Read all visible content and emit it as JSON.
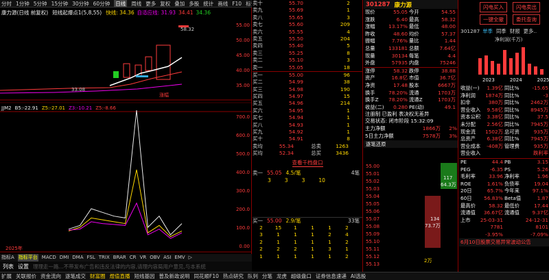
{
  "topbar": {
    "items": [
      "分时",
      "1分钟",
      "5分钟",
      "15分钟",
      "30分钟",
      "60分钟",
      "日线",
      "周线",
      "更多",
      "复权",
      "叠加",
      "多股",
      "统计",
      "画线",
      "F10",
      "标记",
      "-",
      "+",
      "□"
    ],
    "selected": 6
  },
  "chart": {
    "title": "康力源(日线 前复权)",
    "ma_label": "短线起爆点1(5,8,55)",
    "ma_vals": [
      {
        "t": "快线: 34.36",
        "c": "#ffd700"
      },
      {
        "t": "自适应线: 31.93",
        "c": "#e0e"
      },
      {
        "t": "34.41",
        "c": "#ff3b3b"
      },
      {
        "t": "34.36",
        "c": "#22cc22"
      }
    ],
    "high_label": "58.32",
    "low_label": "33.08",
    "price_axis": [
      "55.00",
      "50.00",
      "45.00",
      "40.00",
      "35.00"
    ],
    "tag": "涨幅",
    "ind_label": "JJM2",
    "ind_vals": [
      {
        "t": "B5:-22.91",
        "c": "#eee"
      },
      {
        "t": "Z5:-27.01",
        "c": "#ffd700"
      },
      {
        "t": "Z3:-10.21",
        "c": "#e0e"
      },
      {
        "t": "Z5:-8.66",
        "c": "#ff3b3b"
      }
    ],
    "ind_axis": [
      "700.0",
      "600.0",
      "500.0",
      "400.0",
      "300.0",
      "200.0",
      "100.0",
      "0.00"
    ],
    "year": "2025年",
    "ind_x": [
      0,
      1,
      2,
      3,
      4,
      5,
      6,
      7,
      8,
      9,
      10
    ],
    "ind_series": [
      {
        "c": "#eee",
        "v": [
          60,
          80,
          170,
          150,
          130,
          120,
          700,
          70,
          130,
          30,
          90
        ]
      },
      {
        "t": "",
        "c": "#ffd700",
        "v": [
          50,
          70,
          120,
          110,
          100,
          90,
          380,
          40,
          80,
          20,
          50
        ]
      },
      {
        "c": "#e0e",
        "v": [
          55,
          60,
          100,
          90,
          85,
          80,
          200,
          30,
          60,
          10,
          40
        ]
      }
    ]
  },
  "tabbar": {
    "items": [
      "指标A",
      "指标平台",
      "MACD",
      "DMI",
      "DMA",
      "FSL",
      "TRIX",
      "BRAR",
      "CR",
      "VR",
      "OBV",
      "ASI",
      "EMV",
      "▷"
    ],
    "hl": 1
  },
  "quote": {
    "code": "301287",
    "name": "康力源",
    "sell": [
      {
        "l": "卖十",
        "p": "55.70",
        "v": "2"
      },
      {
        "l": "卖九",
        "p": "55.69",
        "v": "1"
      },
      {
        "l": "卖八",
        "p": "55.65",
        "v": "3"
      },
      {
        "l": "卖七",
        "p": "55.60",
        "v": "209"
      },
      {
        "l": "卖六",
        "p": "55.55",
        "v": "4"
      },
      {
        "l": "卖五",
        "p": "55.50",
        "v": "204"
      },
      {
        "l": "卖四",
        "p": "55.40",
        "v": "5"
      },
      {
        "l": "卖三",
        "p": "55.25",
        "v": "8"
      },
      {
        "l": "卖二",
        "p": "55.10",
        "v": "3"
      },
      {
        "l": "卖一",
        "p": "55.05",
        "v": "18"
      }
    ],
    "buy": [
      {
        "l": "买一",
        "p": "55.00",
        "v": "96"
      },
      {
        "l": "买二",
        "p": "54.99",
        "v": "38"
      },
      {
        "l": "买三",
        "p": "54.98",
        "v": "190"
      },
      {
        "l": "买四",
        "p": "54.97",
        "v": "15"
      },
      {
        "l": "买五",
        "p": "54.96",
        "v": "214"
      },
      {
        "l": "买六",
        "p": "54.95",
        "v": "1"
      },
      {
        "l": "买七",
        "p": "54.94",
        "v": "1"
      },
      {
        "l": "买八",
        "p": "54.93",
        "v": "1"
      },
      {
        "l": "买九",
        "p": "54.92",
        "v": "1"
      },
      {
        "l": "买十",
        "p": "54.91",
        "v": "8"
      }
    ],
    "avg1": "卖均",
    "avg1v": "55.34",
    "avg1t": "总卖",
    "avg1n": "1263",
    "avg2": "买均",
    "avg2v": "52.34",
    "avg2t": "总买",
    "avg2n": "3436",
    "stats": [
      [
        "现价",
        "55.05",
        "今开",
        "54.55"
      ],
      [
        "涨跌",
        "6.40",
        "最高",
        "58.32"
      ],
      [
        "涨幅",
        "13.17%",
        "最低",
        "48.00"
      ],
      [
        "昨收",
        "48.60",
        "均价",
        "57.37"
      ],
      [
        "振幅",
        "7.76%",
        "量比",
        "1.44"
      ],
      [
        "总量",
        "133181",
        "总额",
        "7.64亿"
      ],
      [
        "现量",
        "30134",
        "每笔",
        "4.4"
      ],
      [
        "外盘",
        "57935",
        "内盘",
        "75246"
      ]
    ],
    "stats2": [
      [
        "涨停",
        "58.32",
        "跌停",
        "38.88"
      ],
      [
        "资产",
        "16.8亿",
        "市值",
        "36.7亿"
      ],
      [
        "净资",
        "17.48",
        "股本",
        "6667万"
      ],
      [
        "换手",
        "78.20%",
        "流通",
        "1703万"
      ],
      [
        "换手Z",
        "78.20%",
        "流通Z",
        "1703万"
      ],
      [
        "收益(二)",
        "0.280",
        "PE(动)",
        "49.1"
      ]
    ],
    "notice1": "注册制 已盈利 表决权无差异",
    "notice2": "交易状态: 闭市阶段 15:32:09",
    "main1": "主力净额",
    "main1v": "1866万",
    "main1p": "2%",
    "main2": "5日主力净额",
    "main2v": "7578万",
    "main2p": "3%",
    "depth_btn": "查看千档盘口",
    "s1": "卖一",
    "s1v": "55.05",
    "s1r": "4.5/笔",
    "s1n": "4笔",
    "s1q": [
      "3",
      "3",
      "3",
      "10"
    ],
    "b1": "买一",
    "b1v": "55.00",
    "b1r": "2.9/笔",
    "b1n": "33笔",
    "b1q": [
      [
        "2",
        "15",
        "1",
        "1",
        "1",
        "2"
      ],
      [
        "3",
        "1",
        "1",
        "1",
        "2",
        "4"
      ],
      [
        "2",
        "1",
        "1",
        "1",
        "1",
        "2"
      ],
      [
        "2",
        "2",
        "2",
        "1",
        "3",
        "1"
      ],
      [
        "1",
        "1",
        "1",
        "1",
        "1",
        "2"
      ]
    ]
  },
  "mid": {
    "title": "逐笔还原",
    "rows": [
      "55.00",
      "55.01",
      "55.02",
      "55.03",
      "55.04",
      "55.05",
      "55.06",
      "55.07",
      "55.08",
      "55.09",
      "55.10",
      "55.11",
      "55.12",
      "55.13",
      "55.14",
      "55.15",
      "55.16",
      "55.17",
      "55.18",
      "55.19",
      "55.20",
      "55.21",
      "55.22",
      "55.23",
      "55.24",
      "55.25",
      "55.26",
      "55.27",
      "55.28",
      "55.29",
      "55.30",
      "55.31",
      "55.32",
      "55.33",
      "55.34"
    ],
    "bar1v": "117",
    "bar1p": "64.3万",
    "bar2v": "134",
    "bar2p": "73.7万",
    "foot": "2万"
  },
  "right": {
    "btn_buy": "闪电买入",
    "btn_sell": "闪电卖出",
    "btn_order": "一键全撤",
    "btn_cancel": "委托查询",
    "code": "301287",
    "tabs": [
      "单季",
      "同季",
      "财报",
      "更多.."
    ],
    "unit": "净利润(千万)",
    "years": [
      "2023",
      "2024",
      "2025"
    ],
    "bars": [
      6,
      7,
      5,
      4,
      9,
      6,
      8,
      10,
      4,
      3,
      2
    ],
    "fin": [
      [
        "收益(一)",
        "1.39亿",
        "同比%",
        "-15.65"
      ],
      [
        "净利润",
        "1874万",
        "同比%",
        "-3"
      ],
      [
        "扣非",
        "380万",
        "同比%",
        "2462万"
      ],
      [
        "营业收入",
        "9.58亿",
        "同比%",
        "8945万"
      ],
      [
        "资本公积",
        "3.38亿",
        "同比%",
        "37.5"
      ],
      [
        "未分配",
        "2.56亿",
        "同比%",
        "7945万"
      ],
      [
        "现金流",
        "1502万",
        "总可资",
        "935万"
      ],
      [
        "总资产",
        "6.38亿",
        "同比%",
        "7945万"
      ],
      [
        "营业成本",
        "-408万",
        "管理费",
        "935万"
      ],
      [
        "营业收入",
        "",
        "",
        "跌利率"
      ]
    ],
    "val": [
      [
        "PE",
        "44.4",
        "PB",
        "3.15"
      ],
      [
        "PEG",
        "-6.35",
        "PS",
        "5.26"
      ],
      [
        "毛利率",
        "33.96",
        "净利率",
        "1.96"
      ],
      [
        "ROE",
        "1.61%",
        "负债率",
        "19.04"
      ],
      [
        "20日",
        "65.7%",
        "今年来",
        "97.1%"
      ],
      [
        "60日",
        "56.83%",
        "Beta值",
        "1.87"
      ],
      [
        "最高价",
        "58.32",
        "最低价",
        "17.44"
      ],
      [
        "流通值",
        "36.67亿",
        "流通值",
        "9.37亿"
      ],
      [
        "上市",
        "25-03-31",
        "",
        "24-12-31"
      ],
      [
        "",
        "7781",
        "",
        "8101"
      ],
      [
        "",
        "-3.95%",
        "",
        "-7.09%"
      ]
    ],
    "notice": "6月10日股票交易异常波动公告"
  },
  "bottombar": {
    "items": [
      "扩展",
      "关联报价",
      "资金流向",
      "逐笔成交",
      "财富圈",
      "煜值直播",
      "短线基因",
      "普及新政说明",
      "同花顺F10",
      "热点研究",
      "队列",
      "分笔",
      "龙虎",
      "超级盘口",
      "证券信息速递",
      "AI选股"
    ]
  },
  "list_label": "列表",
  "set_label": "设置",
  "marquee": "理理走一路...不带发布广告和违反法律的内容,请理内容局用户意见,与本系统"
}
